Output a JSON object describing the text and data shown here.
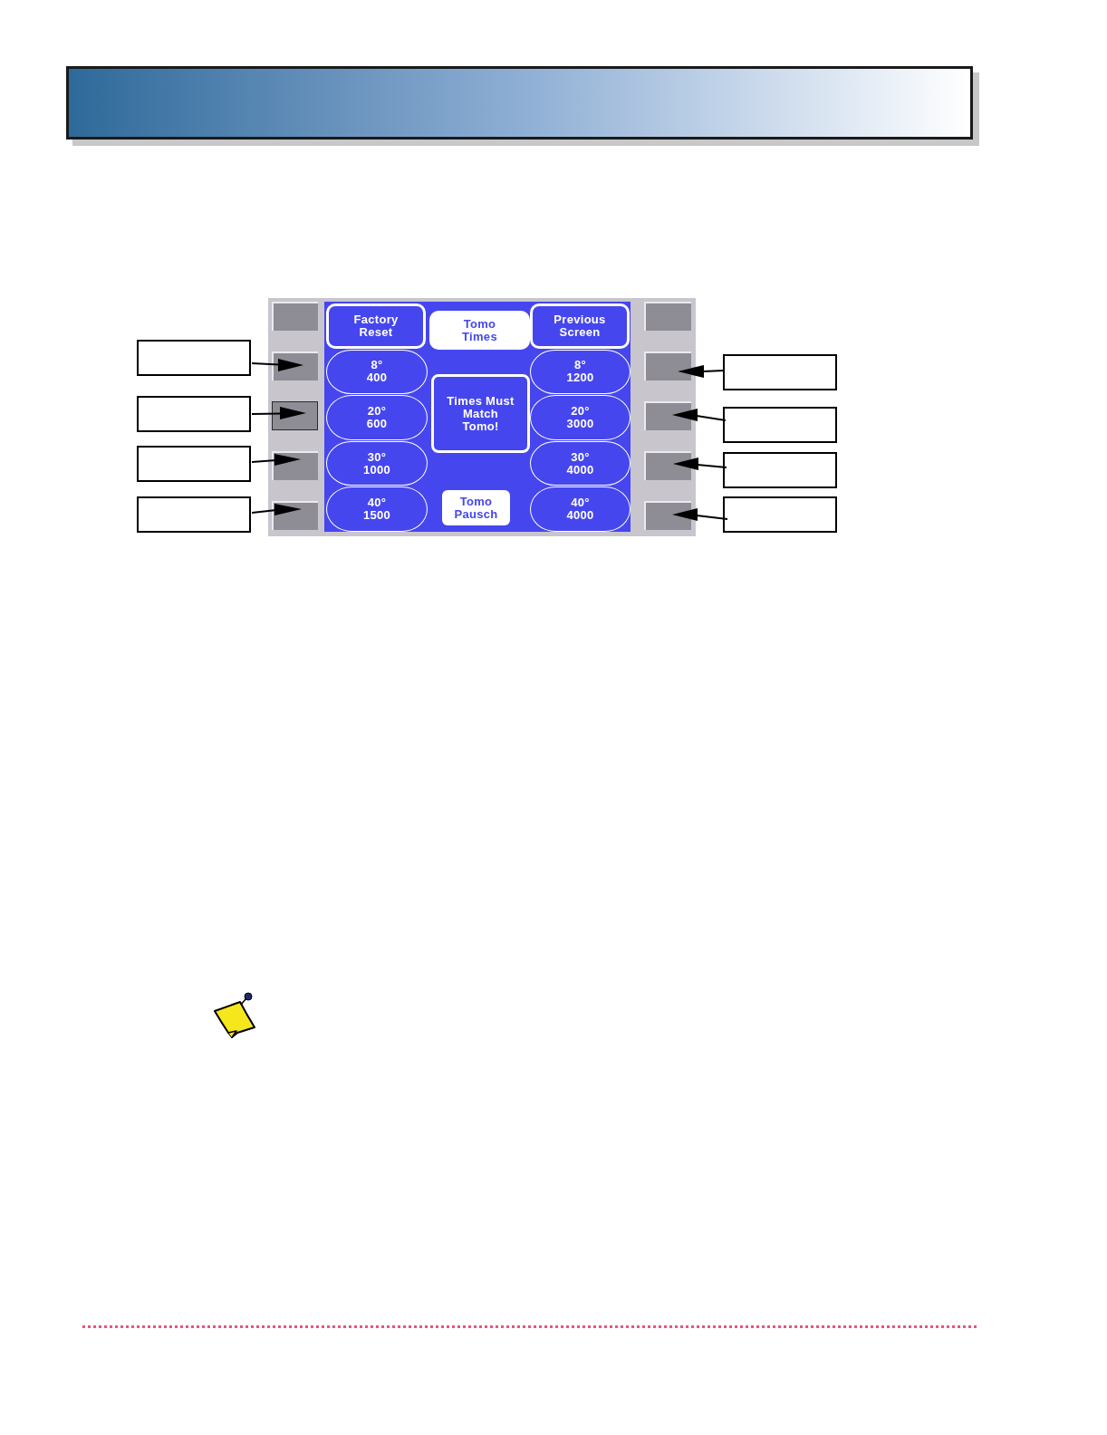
{
  "screen": {
    "top_left_button": "Factory Reset",
    "title": "Tomo Times",
    "top_right_button": "Previous Screen",
    "left_keys": [
      {
        "selected": false
      },
      {
        "selected": false
      },
      {
        "selected": true
      },
      {
        "selected": false
      },
      {
        "selected": false
      }
    ],
    "right_keys": [
      {
        "selected": false
      },
      {
        "selected": false
      },
      {
        "selected": false
      },
      {
        "selected": false
      },
      {
        "selected": false
      }
    ],
    "left_presets": [
      {
        "angle": "8°",
        "time": "400"
      },
      {
        "angle": "20°",
        "time": "600"
      },
      {
        "angle": "30°",
        "time": "1000"
      },
      {
        "angle": "40°",
        "time": "1500"
      }
    ],
    "message": "Times Must Match Tomo!",
    "pause_button": "Tomo Pausch",
    "right_presets": [
      {
        "angle": "8°",
        "time": "1200"
      },
      {
        "angle": "20°",
        "time": "3000"
      },
      {
        "angle": "30°",
        "time": "4000"
      },
      {
        "angle": "40°",
        "time": "4000"
      }
    ]
  }
}
